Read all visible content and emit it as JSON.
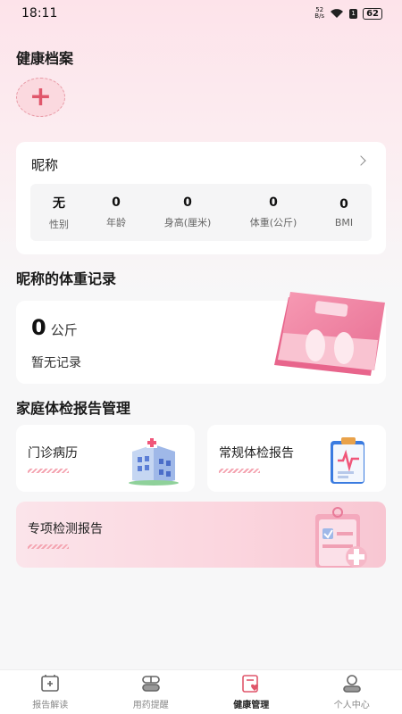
{
  "status_bar": {
    "time": "18:11",
    "net_speed_value": "52",
    "net_speed_unit": "B/s",
    "battery": "62"
  },
  "health_profile": {
    "title": "健康档案",
    "add_label": "+"
  },
  "profile_card": {
    "nickname": "昵称",
    "stats": [
      {
        "value": "无",
        "label": "性别"
      },
      {
        "value": "0",
        "label": "年龄"
      },
      {
        "value": "0",
        "label": "身高(厘米)"
      },
      {
        "value": "0",
        "label": "体重(公斤)"
      },
      {
        "value": "0",
        "label": "BMI"
      }
    ]
  },
  "weight_record": {
    "title": "昵称的体重记录",
    "value": "0",
    "unit": "公斤",
    "empty_text": "暂无记录"
  },
  "family_reports": {
    "title": "家庭体检报告管理",
    "items": [
      {
        "label": "门诊病历",
        "icon": "hospital-icon"
      },
      {
        "label": "常规体检报告",
        "icon": "clipboard-report-icon"
      }
    ],
    "special": {
      "label": "专项检测报告",
      "icon": "test-report-icon"
    }
  },
  "tab_bar": {
    "tabs": [
      {
        "label": "报告解读",
        "icon": "report-read-icon",
        "active": false
      },
      {
        "label": "用药提醒",
        "icon": "pill-icon",
        "active": false
      },
      {
        "label": "健康管理",
        "icon": "health-manage-icon",
        "active": true
      },
      {
        "label": "个人中心",
        "icon": "user-icon",
        "active": false
      }
    ]
  },
  "colors": {
    "accent_pink": "#e0576b",
    "header_gradient": "#fde3ea",
    "active_tab": "#e0576b"
  }
}
